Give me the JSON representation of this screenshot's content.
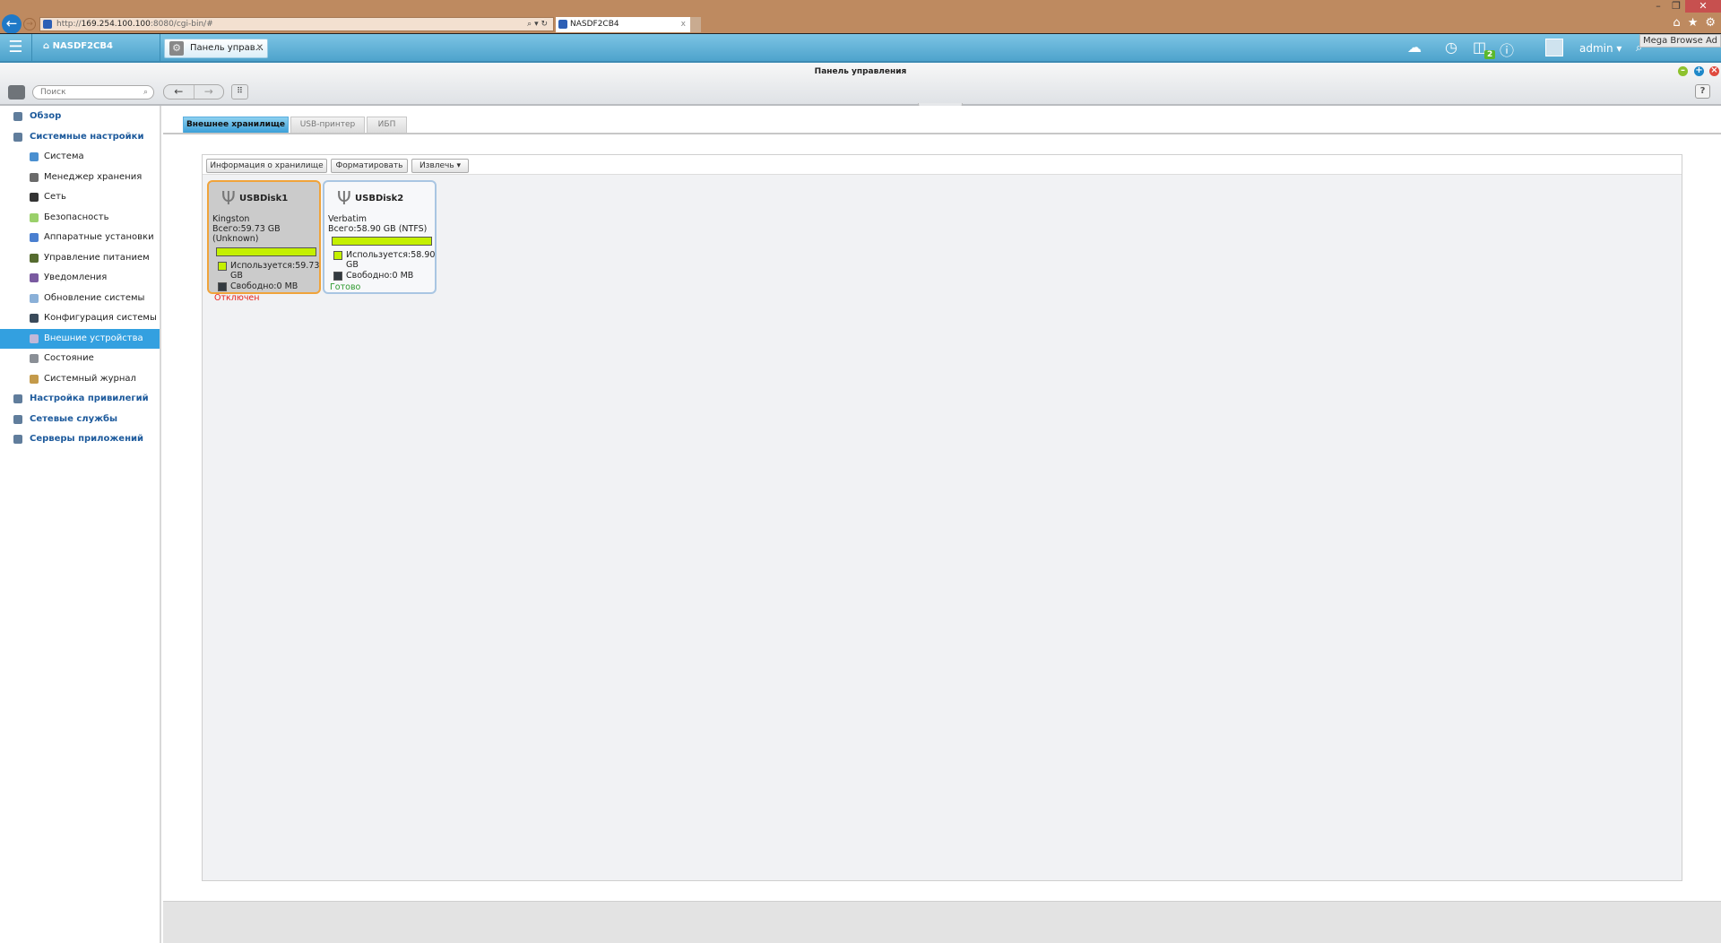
{
  "browser": {
    "url_prefix": "http://",
    "url_host": "169.254.100.100",
    "url_rest": ":8080/cgi-bin/#",
    "tab_title": "NASDF2CB4",
    "tooltip": "Mega Browse Ad"
  },
  "app": {
    "home_label": "NASDF2CB4",
    "open_tab": "Панель управ...",
    "user": "admin",
    "notification_count": "2"
  },
  "window": {
    "title": "Панель управления",
    "help": "?"
  },
  "toolbar": {
    "search_placeholder": "Поиск"
  },
  "sidebar": {
    "items": [
      {
        "label": "Обзор",
        "level": 0
      },
      {
        "label": "Системные настройки",
        "level": 0
      },
      {
        "label": "Система",
        "level": 1
      },
      {
        "label": "Менеджер хранения",
        "level": 1
      },
      {
        "label": "Сеть",
        "level": 1
      },
      {
        "label": "Безопасность",
        "level": 1
      },
      {
        "label": "Аппаратные установки",
        "level": 1
      },
      {
        "label": "Управление питанием",
        "level": 1
      },
      {
        "label": "Уведомления",
        "level": 1
      },
      {
        "label": "Обновление системы",
        "level": 1
      },
      {
        "label": "Конфигурация системы",
        "level": 1
      },
      {
        "label": "Внешние устройства",
        "level": 1,
        "selected": true
      },
      {
        "label": "Состояние",
        "level": 1
      },
      {
        "label": "Системный журнал",
        "level": 1
      },
      {
        "label": "Настройка привилегий",
        "level": 0
      },
      {
        "label": "Сетевые службы",
        "level": 0
      },
      {
        "label": "Серверы приложений",
        "level": 0
      }
    ]
  },
  "tabs": [
    "Внешнее хранилище",
    "USB-принтер",
    "ИБП"
  ],
  "buttons": {
    "info": "Информация о хранилище",
    "format": "Форматировать",
    "eject": "Извлечь"
  },
  "disks": [
    {
      "name": "USBDisk1",
      "vendor": "Kingston",
      "total": "Всего:59.73 GB",
      "fs": "(Unknown)",
      "used": "Используется:59.73 GB",
      "free": "Свободно:0 MB",
      "status": "Отключен",
      "used_fraction": 1.0
    },
    {
      "name": "USBDisk2",
      "vendor": "Verbatim",
      "total": "Всего:58.90 GB (NTFS)",
      "used": "Используется:58.90 GB",
      "free": "Свободно:0 MB",
      "status": "Готово",
      "used_fraction": 1.0
    }
  ],
  "colors": {
    "accent": "#33a0e0",
    "used": "#c4f000",
    "free": "#333a40",
    "status_off": "#e8221b",
    "status_ok": "#2f9a2f"
  }
}
